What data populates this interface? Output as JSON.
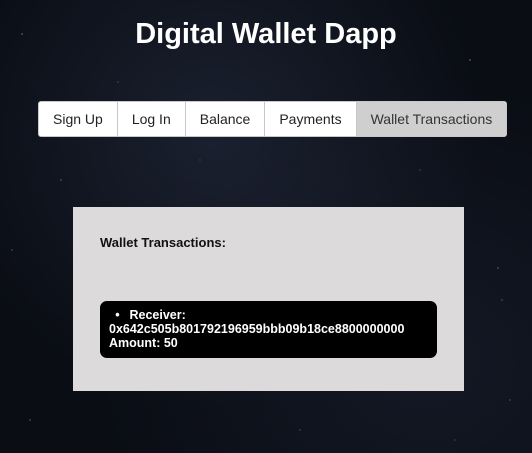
{
  "app": {
    "title": "Digital Wallet Dapp"
  },
  "tabs": [
    {
      "label": "Sign Up",
      "active": false
    },
    {
      "label": "Log In",
      "active": false
    },
    {
      "label": "Balance",
      "active": false
    },
    {
      "label": "Payments",
      "active": false
    },
    {
      "label": "Wallet Transactions",
      "active": true
    }
  ],
  "panel": {
    "heading": "Wallet Transactions:",
    "transactions": [
      {
        "receiver_label": "Receiver:",
        "receiver": "0x642c505b801792196959bbb09b18ce8800000000",
        "amount_label": "Amount:",
        "amount": "50"
      }
    ]
  },
  "colors": {
    "background": "#0a0d14",
    "panel": "#dcdada",
    "transaction_card": "#000000",
    "active_tab": "#cfcfcf"
  },
  "icons": {
    "list_bullet": "•"
  }
}
